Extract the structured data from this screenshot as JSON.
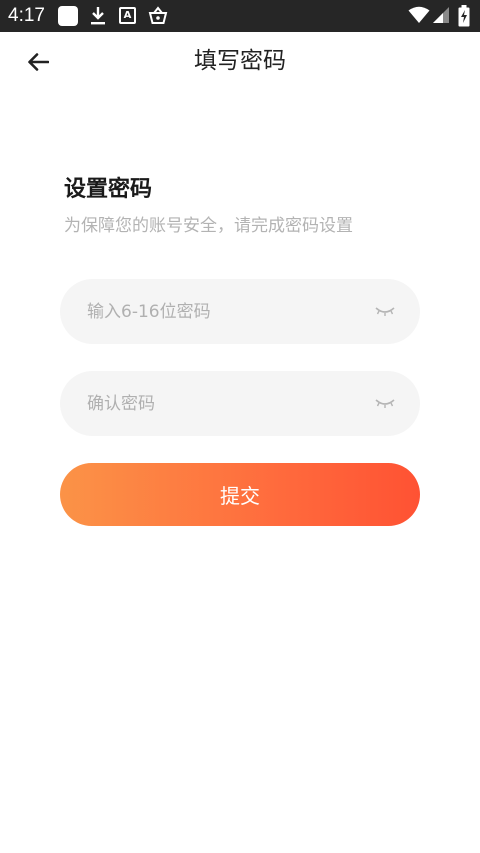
{
  "status_bar": {
    "time": "4:17",
    "icons": [
      "app-square-icon",
      "download-icon",
      "a-badge-icon",
      "basket-icon",
      "wifi-icon",
      "signal-icon",
      "battery-icon"
    ],
    "a_badge_text": "A"
  },
  "app_bar": {
    "back_icon": "arrow-left-icon",
    "title": "填写密码"
  },
  "form": {
    "heading": "设置密码",
    "subheading": "为保障您的账号安全，请完成密码设置",
    "password_placeholder": "输入6-16位密码",
    "password_value": "",
    "confirm_placeholder": "确认密码",
    "confirm_value": "",
    "eye_icon": "eye-closed-icon",
    "submit_label": "提交"
  },
  "colors": {
    "status_bar_bg": "#262626",
    "field_bg": "#f5f5f5",
    "submit_gradient_start": "#fb9347",
    "submit_gradient_end": "#ff5233",
    "placeholder": "#b0b0b0"
  }
}
